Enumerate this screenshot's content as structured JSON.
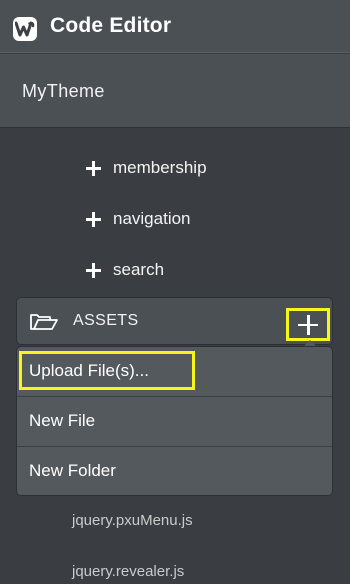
{
  "app": {
    "title": "Code Editor",
    "logo_icon": "weebly-w-logo-icon"
  },
  "theme": {
    "name": "MyTheme"
  },
  "folders": [
    {
      "label": "membership",
      "icon": "plus-icon"
    },
    {
      "label": "navigation",
      "icon": "plus-icon"
    },
    {
      "label": "search",
      "icon": "plus-icon"
    }
  ],
  "assets": {
    "label": "ASSETS",
    "icon": "folder-open-icon",
    "add_icon": "plus-icon"
  },
  "dropdown": {
    "items": [
      {
        "label": "Upload File(s)..."
      },
      {
        "label": "New File"
      },
      {
        "label": "New Folder"
      }
    ]
  },
  "files": [
    {
      "label": "jquery.pxuMenu.js"
    },
    {
      "label": "jquery.revealer.js"
    }
  ],
  "colors": {
    "background": "#3a3e42",
    "panel": "#4b5055",
    "dropdown": "#54595e",
    "highlight": "#f7f61a",
    "text": "#ffffff"
  }
}
